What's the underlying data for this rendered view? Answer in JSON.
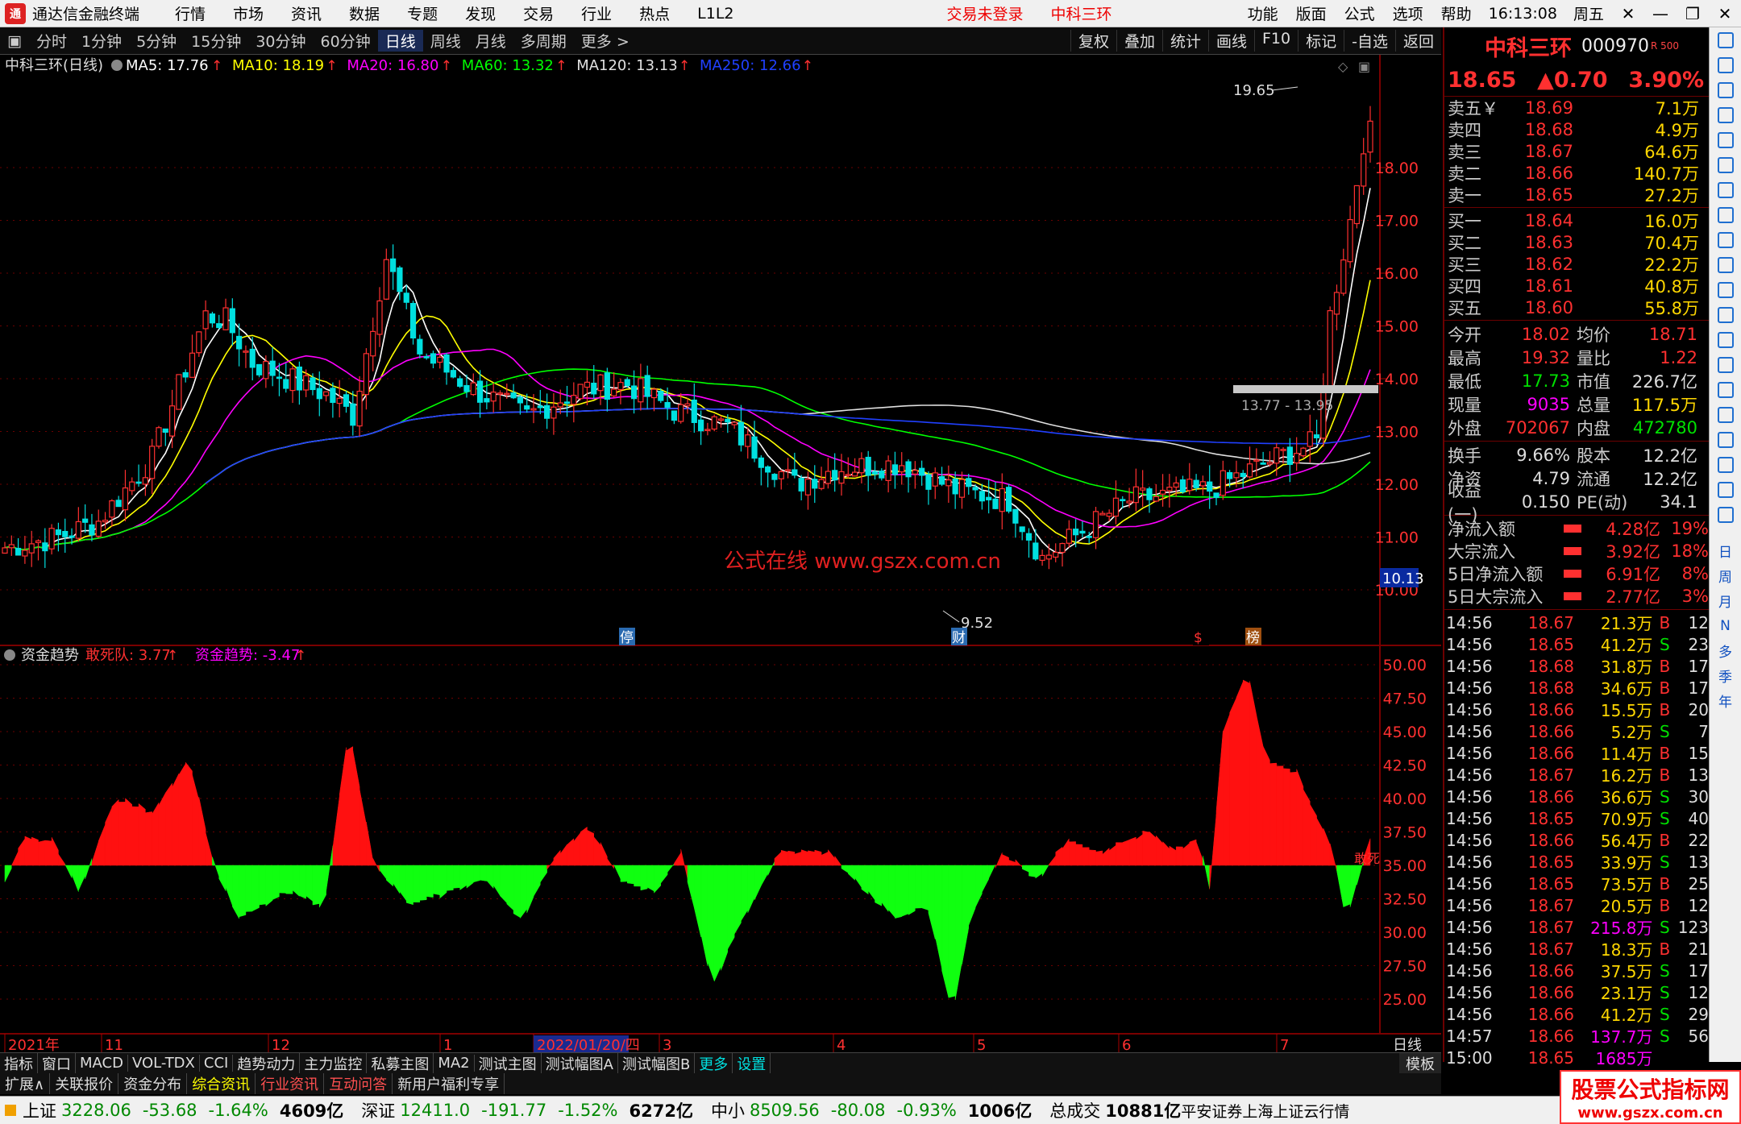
{
  "menubar": {
    "app_title": "通达信金融终端",
    "items": [
      "行情",
      "市场",
      "资讯",
      "数据",
      "专题",
      "发现",
      "交易",
      "行业",
      "热点",
      "L1L2"
    ],
    "warning": "交易未登录",
    "warn_stock": "中科三环",
    "right_items": [
      "功能",
      "版面",
      "公式",
      "选项",
      "帮助"
    ],
    "time": "16:13:08",
    "weekday": "周五"
  },
  "periodbar": {
    "periods": [
      "分时",
      "1分钟",
      "5分钟",
      "15分钟",
      "30分钟",
      "60分钟",
      "日线",
      "周线",
      "月线",
      "多周期",
      "更多 >"
    ],
    "active": "日线",
    "tools": [
      "复权",
      "叠加",
      "统计",
      "画线",
      "F10",
      "标记",
      "-自选",
      "返回"
    ]
  },
  "main_chart": {
    "title": "中科三环(日线)",
    "ma_labels": [
      {
        "text": "MA5: 17.76",
        "color": "#ffffff"
      },
      {
        "text": "MA10: 18.19",
        "color": "#ffff00"
      },
      {
        "text": "MA20: 16.80",
        "color": "#ff00ff"
      },
      {
        "text": "MA60: 13.32",
        "color": "#00ff00"
      },
      {
        "text": "MA120: 13.13",
        "color": "#e0e0e0"
      },
      {
        "text": "MA250: 12.66",
        "color": "#2040ff"
      }
    ],
    "y_ticks": [
      "18.00",
      "17.00",
      "16.00",
      "15.00",
      "14.00",
      "13.00",
      "12.00",
      "11.00",
      "10.00"
    ],
    "high_label": "19.65",
    "low_label": "9.52",
    "range_label": "13.77 - 13.95",
    "current_price_tag": "10.13",
    "watermark": "公式在线  www.gszx.com.cn",
    "markers": [
      "停",
      "财",
      "$",
      "榜"
    ]
  },
  "sub_chart": {
    "title": "资金趋势",
    "label1": "敢死队: 3.77",
    "label2": "资金趋势: -3.47",
    "y_ticks": [
      "50.00",
      "47.50",
      "45.00",
      "42.50",
      "40.00",
      "37.50",
      "35.00",
      "32.50",
      "30.00",
      "27.50",
      "25.00"
    ],
    "end_label": "敢死"
  },
  "xaxis": {
    "labels": [
      "2021年",
      "11",
      "12",
      "1",
      "2022/01/20/四",
      "3",
      "4",
      "5",
      "6",
      "7"
    ],
    "corner": "日线"
  },
  "quote": {
    "name": "中科三环",
    "code": "000970",
    "mark": "R 500",
    "price": "18.65",
    "change": "▲0.70",
    "pct": "3.90%",
    "asks": [
      {
        "label": "卖五￥",
        "price": "18.69",
        "vol": "7.1万"
      },
      {
        "label": "卖四",
        "price": "18.68",
        "vol": "4.9万"
      },
      {
        "label": "卖三",
        "price": "18.67",
        "vol": "64.6万"
      },
      {
        "label": "卖二",
        "price": "18.66",
        "vol": "140.7万"
      },
      {
        "label": "卖一",
        "price": "18.65",
        "vol": "27.2万"
      }
    ],
    "bids": [
      {
        "label": "买一",
        "price": "18.64",
        "vol": "16.0万"
      },
      {
        "label": "买二",
        "price": "18.63",
        "vol": "70.4万"
      },
      {
        "label": "买三",
        "price": "18.62",
        "vol": "22.2万"
      },
      {
        "label": "买四",
        "price": "18.61",
        "vol": "40.8万"
      },
      {
        "label": "买五",
        "price": "18.60",
        "vol": "55.8万"
      }
    ],
    "stats1": [
      [
        "今开",
        "18.02",
        "均价",
        "18.71",
        "#ff3030",
        "#ff3030"
      ],
      [
        "最高",
        "19.32",
        "量比",
        "1.22",
        "#ff3030",
        "#ff3030"
      ],
      [
        "最低",
        "17.73",
        "市值",
        "226.7亿",
        "#00e000",
        "#ddd"
      ],
      [
        "现量",
        "9035",
        "总量",
        "117.5万",
        "#ff00ff",
        "#ffd700"
      ],
      [
        "外盘",
        "702067",
        "内盘",
        "472780",
        "#ff3030",
        "#00e000"
      ]
    ],
    "stats2": [
      [
        "换手",
        "9.66%",
        "股本",
        "12.2亿"
      ],
      [
        "净资",
        "4.79",
        "流通",
        "12.2亿"
      ],
      [
        "收益(一)",
        "0.150",
        "PE(动)",
        "34.1"
      ]
    ],
    "fund_flows": [
      {
        "label": "净流入额",
        "value": "4.28亿",
        "pct": "19%"
      },
      {
        "label": "大宗流入",
        "value": "3.92亿",
        "pct": "18%"
      },
      {
        "label": "5日净流入额",
        "value": "6.91亿",
        "pct": "8%"
      },
      {
        "label": "5日大宗流入",
        "value": "2.77亿",
        "pct": "3%"
      }
    ],
    "ticks": [
      [
        "14:56",
        "18.67",
        "21.3万",
        "B",
        "12"
      ],
      [
        "14:56",
        "18.65",
        "41.2万",
        "S",
        "23"
      ],
      [
        "14:56",
        "18.68",
        "31.8万",
        "B",
        "17"
      ],
      [
        "14:56",
        "18.68",
        "34.6万",
        "B",
        "17"
      ],
      [
        "14:56",
        "18.66",
        "15.5万",
        "B",
        "20"
      ],
      [
        "14:56",
        "18.66",
        "5.2万",
        "S",
        "7"
      ],
      [
        "14:56",
        "18.66",
        "11.4万",
        "B",
        "15"
      ],
      [
        "14:56",
        "18.67",
        "16.2万",
        "B",
        "13"
      ],
      [
        "14:56",
        "18.66",
        "36.6万",
        "S",
        "30"
      ],
      [
        "14:56",
        "18.65",
        "70.9万",
        "S",
        "40"
      ],
      [
        "14:56",
        "18.66",
        "56.4万",
        "B",
        "22"
      ],
      [
        "14:56",
        "18.65",
        "33.9万",
        "S",
        "13"
      ],
      [
        "14:56",
        "18.65",
        "73.5万",
        "B",
        "25"
      ],
      [
        "14:56",
        "18.67",
        "20.5万",
        "B",
        "12"
      ],
      [
        "14:56",
        "18.67",
        "215.8万",
        "S",
        "123"
      ],
      [
        "14:56",
        "18.67",
        "18.3万",
        "B",
        "21"
      ],
      [
        "14:56",
        "18.66",
        "37.5万",
        "S",
        "17"
      ],
      [
        "14:56",
        "18.66",
        "23.1万",
        "S",
        "12"
      ],
      [
        "14:56",
        "18.66",
        "41.2万",
        "S",
        "29"
      ],
      [
        "14:57",
        "18.66",
        "137.7万",
        "S",
        "56"
      ],
      [
        "15:00",
        "18.65",
        "1685万",
        "",
        ""
      ]
    ]
  },
  "tabbar1": {
    "tabs": [
      "指标",
      "窗口",
      "MACD",
      "VOL-TDX",
      "CCI",
      "趋势动力",
      "主力监控",
      "私募主图",
      "MA2",
      "测试主图",
      "测试幅图A",
      "测试幅图B",
      "更多",
      "设置"
    ],
    "right": "模板"
  },
  "tabbar2": {
    "tabs": [
      "扩展∧",
      "关联报价",
      "资金分布",
      "综合资讯",
      "行业资讯",
      "互动问答",
      "新用户福利专享"
    ]
  },
  "statusbar": [
    {
      "name": "上证",
      "val": "3228.06",
      "chg": "-53.68",
      "pct": "-1.64%",
      "amt": "4609亿"
    },
    {
      "name": "深证",
      "val": "12411.0",
      "chg": "-191.77",
      "pct": "-1.52%",
      "amt": "6272亿"
    },
    {
      "name": "中小",
      "val": "8509.56",
      "chg": "-80.08",
      "pct": "-0.93%",
      "amt": "1006亿"
    }
  ],
  "total": {
    "label": "总成交",
    "value": "10881亿",
    "broker": "平安证券上海上证云行情"
  },
  "brand": {
    "line1": "股票公式指标网",
    "line2": "www.gszx.com.cn"
  },
  "sidetools": [
    "日",
    "周",
    "月",
    "N",
    "多",
    "季",
    "年"
  ],
  "colors": {
    "up": "#ff3030",
    "down": "#00e0e0",
    "green": "#00ff00",
    "red": "#ff0000"
  }
}
